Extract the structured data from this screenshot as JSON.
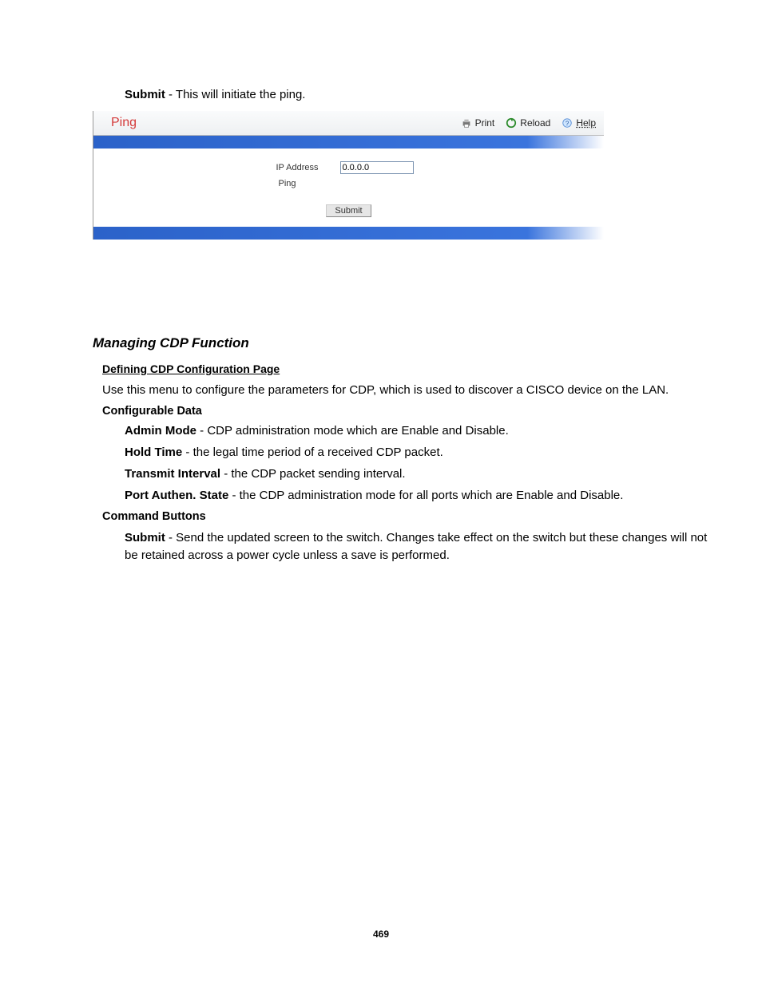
{
  "top_submit_bold": "Submit",
  "top_submit_rest": " - This will initiate the ping.",
  "panel": {
    "title": "Ping",
    "print": "Print",
    "reload": "Reload",
    "help": "Help",
    "ip_label": "IP Address",
    "ip_value": "0.0.0.0",
    "ping_label": "Ping",
    "submit_btn": "Submit"
  },
  "section_heading": "Managing CDP Function",
  "sub_heading": "Defining CDP Configuration Page",
  "intro": "Use this menu to configure the parameters for CDP, which is used to discover a CISCO device on the LAN.",
  "configurable_label": "Configurable Data",
  "fields": {
    "admin_mode_b": "Admin Mode",
    "admin_mode_t": " - CDP administration mode which are Enable and Disable.",
    "hold_time_b": "Hold Time",
    "hold_time_t": " - the legal time period of a received CDP packet.",
    "transmit_b": "Transmit Interval",
    "transmit_t": " - the CDP packet sending interval.",
    "port_auth_b": "Port Authen. State",
    "port_auth_t": " - the CDP administration mode for all ports which are Enable and Disable."
  },
  "command_label": "Command Buttons",
  "cmd_submit_b": "Submit",
  "cmd_submit_t": " - Send the updated screen to the switch. Changes take effect on the switch but these changes will not be retained across a power cycle unless a save is performed.",
  "page_number": "469"
}
